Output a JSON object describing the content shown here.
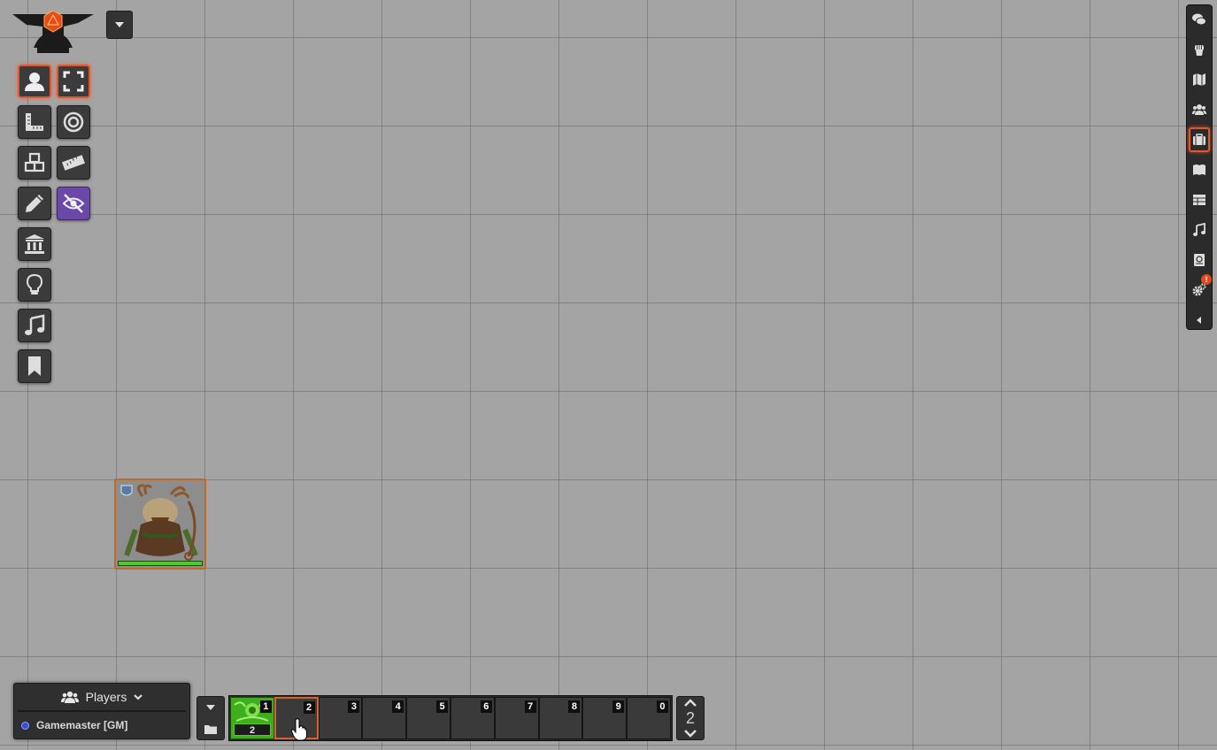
{
  "scene_controls": [
    {
      "name": "token-controls",
      "icon": "user-icon",
      "active": true
    },
    {
      "name": "fullscreen-controls",
      "icon": "expand-icon",
      "active": true
    },
    {
      "name": "measurement-controls",
      "icon": "ruler-square-icon",
      "active": false
    },
    {
      "name": "target-tool",
      "icon": "bullseye-icon",
      "active": false
    },
    {
      "name": "tile-controls",
      "icon": "cubes-icon",
      "active": false
    },
    {
      "name": "ruler-tool",
      "icon": "ruler-icon",
      "active": false
    },
    {
      "name": "drawing-controls",
      "icon": "pencil-icon",
      "active": false
    },
    {
      "name": "vision-toggle",
      "icon": "eye-slash-icon",
      "active": true
    },
    {
      "name": "wall-controls",
      "icon": "landmark-icon",
      "active": false
    },
    {
      "name": "lighting-controls",
      "icon": "lightbulb-icon",
      "active": false
    },
    {
      "name": "sound-controls",
      "icon": "music-icon",
      "active": false
    },
    {
      "name": "notes-controls",
      "icon": "bookmark-icon",
      "active": false
    }
  ],
  "sidebar_tabs": [
    {
      "name": "chat",
      "icon": "comments-icon"
    },
    {
      "name": "combat",
      "icon": "fist-icon"
    },
    {
      "name": "scenes",
      "icon": "map-icon"
    },
    {
      "name": "actors",
      "icon": "users-icon"
    },
    {
      "name": "items",
      "icon": "suitcase-icon",
      "active": true
    },
    {
      "name": "journal",
      "icon": "book-open-icon"
    },
    {
      "name": "tables",
      "icon": "table-icon"
    },
    {
      "name": "playlists",
      "icon": "music-icon"
    },
    {
      "name": "compendium",
      "icon": "atlas-icon"
    },
    {
      "name": "settings",
      "icon": "cogs-icon",
      "badge": "!"
    },
    {
      "name": "collapse",
      "icon": "caret-left-icon"
    }
  ],
  "players": {
    "header": "Players",
    "list": [
      {
        "name": "Gamemaster [GM]"
      }
    ]
  },
  "hotbar": {
    "page": "2",
    "slots": [
      {
        "number": "1",
        "filled": true,
        "count": "2"
      },
      {
        "number": "2",
        "filled": false,
        "hover": true
      },
      {
        "number": "3"
      },
      {
        "number": "4"
      },
      {
        "number": "5"
      },
      {
        "number": "6"
      },
      {
        "number": "7"
      },
      {
        "number": "8"
      },
      {
        "number": "9"
      },
      {
        "number": "0"
      }
    ]
  },
  "colors": {
    "canvas": "#a4a4a4",
    "active_border": "#e0582d",
    "vision_toggle": "#6a48a8",
    "health_bar": "#4ccb23"
  }
}
